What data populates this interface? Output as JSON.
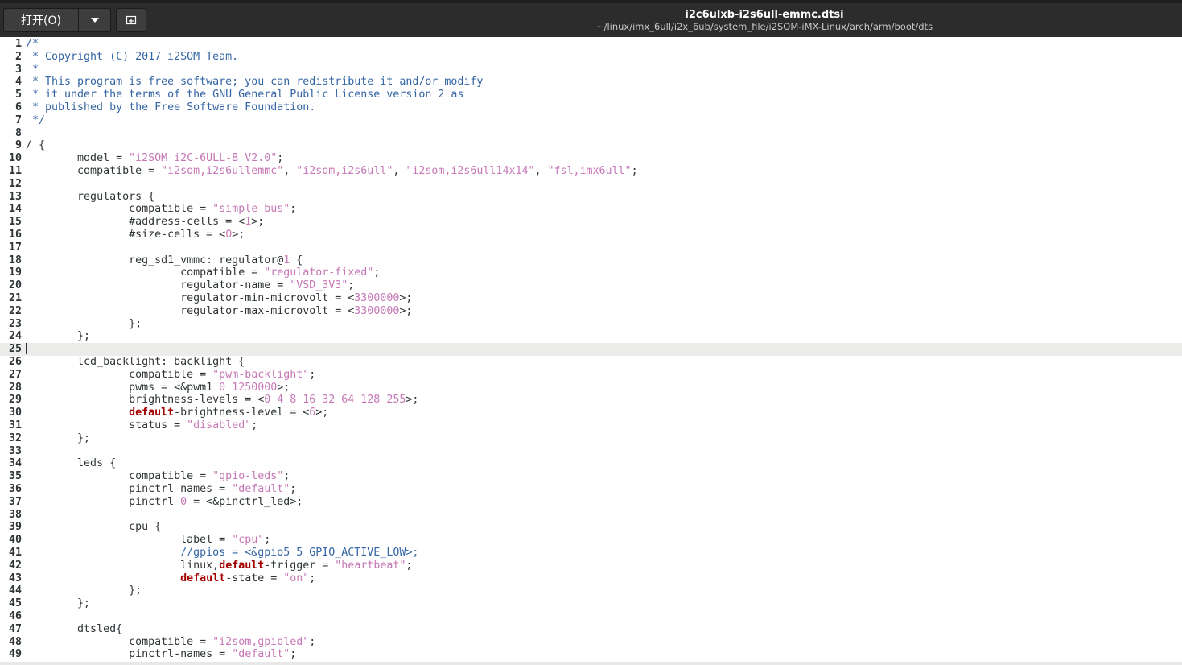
{
  "header": {
    "open_label": "打开(O)",
    "pin_icon": "new-tab-icon",
    "title": "i2c6ulxb-i2s6ull-emmc.dtsi",
    "subtitle": "~/linux/imx_6ull/i2x_6ub/system_file/i2SOM-iMX-Linux/arch/arm/boot/dts"
  },
  "colors": {
    "comment": "#3465a4",
    "string": "#c677b6",
    "number": "#c677b6",
    "keyword": "#a40000",
    "text": "#2e3436",
    "current_line": "#ecedeb"
  },
  "editor": {
    "current_line": 25,
    "lines": [
      {
        "n": "1",
        "segs": [
          {
            "t": "/*",
            "c": "comment"
          }
        ]
      },
      {
        "n": "2",
        "segs": [
          {
            "t": " * Copyright (C) 2017 i2SOM Team.",
            "c": "comment"
          }
        ]
      },
      {
        "n": "3",
        "segs": [
          {
            "t": " *",
            "c": "comment"
          }
        ]
      },
      {
        "n": "4",
        "segs": [
          {
            "t": " * This program is free software; you can redistribute it and/or modify",
            "c": "comment"
          }
        ]
      },
      {
        "n": "5",
        "segs": [
          {
            "t": " * it under the terms of the GNU General Public License version 2 as",
            "c": "comment"
          }
        ]
      },
      {
        "n": "6",
        "segs": [
          {
            "t": " * published by the Free Software Foundation.",
            "c": "comment"
          }
        ]
      },
      {
        "n": "7",
        "segs": [
          {
            "t": " */",
            "c": "comment"
          }
        ]
      },
      {
        "n": "8",
        "segs": []
      },
      {
        "n": "9",
        "segs": [
          {
            "t": "/ {",
            "c": "text"
          }
        ]
      },
      {
        "n": "10",
        "segs": [
          {
            "t": "\tmodel = ",
            "c": "text"
          },
          {
            "t": "\"i2SOM i2C-6ULL-B V2.0\"",
            "c": "string"
          },
          {
            "t": ";",
            "c": "text"
          }
        ]
      },
      {
        "n": "11",
        "segs": [
          {
            "t": "\tcompatible = ",
            "c": "text"
          },
          {
            "t": "\"i2som,i2s6ullemmc\"",
            "c": "string"
          },
          {
            "t": ", ",
            "c": "text"
          },
          {
            "t": "\"i2som,i2s6ull\"",
            "c": "string"
          },
          {
            "t": ", ",
            "c": "text"
          },
          {
            "t": "\"i2som,i2s6ull14x14\"",
            "c": "string"
          },
          {
            "t": ", ",
            "c": "text"
          },
          {
            "t": "\"fsl,imx6ull\"",
            "c": "string"
          },
          {
            "t": ";",
            "c": "text"
          }
        ]
      },
      {
        "n": "12",
        "segs": []
      },
      {
        "n": "13",
        "segs": [
          {
            "t": "\tregulators {",
            "c": "text"
          }
        ]
      },
      {
        "n": "14",
        "segs": [
          {
            "t": "\t\tcompatible = ",
            "c": "text"
          },
          {
            "t": "\"simple-bus\"",
            "c": "string"
          },
          {
            "t": ";",
            "c": "text"
          }
        ]
      },
      {
        "n": "15",
        "segs": [
          {
            "t": "\t\t#address-cells = <",
            "c": "text"
          },
          {
            "t": "1",
            "c": "number"
          },
          {
            "t": ">;",
            "c": "text"
          }
        ]
      },
      {
        "n": "16",
        "segs": [
          {
            "t": "\t\t#size-cells = <",
            "c": "text"
          },
          {
            "t": "0",
            "c": "number"
          },
          {
            "t": ">;",
            "c": "text"
          }
        ]
      },
      {
        "n": "17",
        "segs": []
      },
      {
        "n": "18",
        "segs": [
          {
            "t": "\t\treg_sd1_vmmc: regulator@",
            "c": "text"
          },
          {
            "t": "1",
            "c": "number"
          },
          {
            "t": " {",
            "c": "text"
          }
        ]
      },
      {
        "n": "19",
        "segs": [
          {
            "t": "\t\t\tcompatible = ",
            "c": "text"
          },
          {
            "t": "\"regulator-fixed\"",
            "c": "string"
          },
          {
            "t": ";",
            "c": "text"
          }
        ]
      },
      {
        "n": "20",
        "segs": [
          {
            "t": "\t\t\tregulator-name = ",
            "c": "text"
          },
          {
            "t": "\"VSD_3V3\"",
            "c": "string"
          },
          {
            "t": ";",
            "c": "text"
          }
        ]
      },
      {
        "n": "21",
        "segs": [
          {
            "t": "\t\t\tregulator-min-microvolt = <",
            "c": "text"
          },
          {
            "t": "3300000",
            "c": "number"
          },
          {
            "t": ">;",
            "c": "text"
          }
        ]
      },
      {
        "n": "22",
        "segs": [
          {
            "t": "\t\t\tregulator-max-microvolt = <",
            "c": "text"
          },
          {
            "t": "3300000",
            "c": "number"
          },
          {
            "t": ">;",
            "c": "text"
          }
        ]
      },
      {
        "n": "23",
        "segs": [
          {
            "t": "\t\t};",
            "c": "text"
          }
        ]
      },
      {
        "n": "24",
        "segs": [
          {
            "t": "\t};",
            "c": "text"
          }
        ]
      },
      {
        "n": "25",
        "segs": []
      },
      {
        "n": "26",
        "segs": [
          {
            "t": "\tlcd_backlight: backlight {",
            "c": "text"
          }
        ]
      },
      {
        "n": "27",
        "segs": [
          {
            "t": "\t\tcompatible = ",
            "c": "text"
          },
          {
            "t": "\"pwm-backlight\"",
            "c": "string"
          },
          {
            "t": ";",
            "c": "text"
          }
        ]
      },
      {
        "n": "28",
        "segs": [
          {
            "t": "\t\tpwms = <&pwm1 ",
            "c": "text"
          },
          {
            "t": "0 1250000",
            "c": "number"
          },
          {
            "t": ">;",
            "c": "text"
          }
        ]
      },
      {
        "n": "29",
        "segs": [
          {
            "t": "\t\tbrightness-levels = <",
            "c": "text"
          },
          {
            "t": "0 4 8 16 32 64 128 255",
            "c": "number"
          },
          {
            "t": ">;",
            "c": "text"
          }
        ]
      },
      {
        "n": "30",
        "segs": [
          {
            "t": "\t\t",
            "c": "text"
          },
          {
            "t": "default",
            "c": "keyword"
          },
          {
            "t": "-brightness-level = <",
            "c": "text"
          },
          {
            "t": "6",
            "c": "number"
          },
          {
            "t": ">;",
            "c": "text"
          }
        ]
      },
      {
        "n": "31",
        "segs": [
          {
            "t": "\t\tstatus = ",
            "c": "text"
          },
          {
            "t": "\"disabled\"",
            "c": "string"
          },
          {
            "t": ";",
            "c": "text"
          }
        ]
      },
      {
        "n": "32",
        "segs": [
          {
            "t": "\t};",
            "c": "text"
          }
        ]
      },
      {
        "n": "33",
        "segs": []
      },
      {
        "n": "34",
        "segs": [
          {
            "t": "\tleds {",
            "c": "text"
          }
        ]
      },
      {
        "n": "35",
        "segs": [
          {
            "t": "\t\tcompatible = ",
            "c": "text"
          },
          {
            "t": "\"gpio-leds\"",
            "c": "string"
          },
          {
            "t": ";",
            "c": "text"
          }
        ]
      },
      {
        "n": "36",
        "segs": [
          {
            "t": "\t\tpinctrl-names = ",
            "c": "text"
          },
          {
            "t": "\"default\"",
            "c": "string"
          },
          {
            "t": ";",
            "c": "text"
          }
        ]
      },
      {
        "n": "37",
        "segs": [
          {
            "t": "\t\tpinctrl-",
            "c": "text"
          },
          {
            "t": "0",
            "c": "number"
          },
          {
            "t": " = <&pinctrl_led>;",
            "c": "text"
          }
        ]
      },
      {
        "n": "38",
        "segs": []
      },
      {
        "n": "39",
        "segs": [
          {
            "t": "\t\tcpu {",
            "c": "text"
          }
        ]
      },
      {
        "n": "40",
        "segs": [
          {
            "t": "\t\t\tlabel = ",
            "c": "text"
          },
          {
            "t": "\"cpu\"",
            "c": "string"
          },
          {
            "t": ";",
            "c": "text"
          }
        ]
      },
      {
        "n": "41",
        "segs": [
          {
            "t": "\t\t\t",
            "c": "text"
          },
          {
            "t": "//gpios = <&gpio5 5 GPIO_ACTIVE_LOW>;",
            "c": "comment"
          }
        ]
      },
      {
        "n": "42",
        "segs": [
          {
            "t": "\t\t\tlinux,",
            "c": "text"
          },
          {
            "t": "default",
            "c": "keyword"
          },
          {
            "t": "-trigger = ",
            "c": "text"
          },
          {
            "t": "\"heartbeat\"",
            "c": "string"
          },
          {
            "t": ";",
            "c": "text"
          }
        ]
      },
      {
        "n": "43",
        "segs": [
          {
            "t": "\t\t\t",
            "c": "text"
          },
          {
            "t": "default",
            "c": "keyword"
          },
          {
            "t": "-state = ",
            "c": "text"
          },
          {
            "t": "\"on\"",
            "c": "string"
          },
          {
            "t": ";",
            "c": "text"
          }
        ]
      },
      {
        "n": "44",
        "segs": [
          {
            "t": "\t\t};",
            "c": "text"
          }
        ]
      },
      {
        "n": "45",
        "segs": [
          {
            "t": "\t};",
            "c": "text"
          }
        ]
      },
      {
        "n": "46",
        "segs": []
      },
      {
        "n": "47",
        "segs": [
          {
            "t": "\tdtsled{",
            "c": "text"
          }
        ]
      },
      {
        "n": "48",
        "segs": [
          {
            "t": "\t\tcompatible = ",
            "c": "text"
          },
          {
            "t": "\"i2som,gpioled\"",
            "c": "string"
          },
          {
            "t": ";",
            "c": "text"
          }
        ]
      },
      {
        "n": "49",
        "segs": [
          {
            "t": "\t\tpinctrl-names = ",
            "c": "text"
          },
          {
            "t": "\"default\"",
            "c": "string"
          },
          {
            "t": ";",
            "c": "text"
          }
        ]
      }
    ]
  }
}
